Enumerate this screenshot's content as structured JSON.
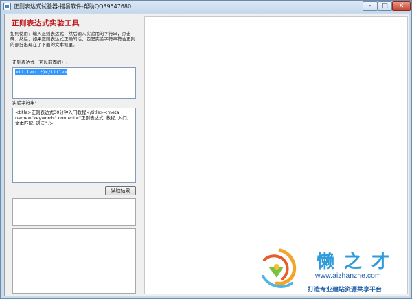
{
  "window": {
    "title": "正则表达式试验器-搭易软件-帮助QQ39547680",
    "minimize_glyph": "–",
    "maximize_glyph": "□",
    "close_glyph": "✕"
  },
  "panel": {
    "heading": "正则表达式实验工具",
    "intro": "如何使用？输入正则表达式，然后输入实验用的字符串，点击确，然后，如果正则表达式正确的话，匹配实验字符串符合正则的部分出现在了下面的文本框里。",
    "regex_label": "正则表达式（可以前面的）:",
    "regex_value": "<title>(.*)</title>",
    "test_label": "实验字符串:",
    "test_value": "<title>正则表达式30分钟入门教程</title><meta name=\"keywords\" content=\"正则表达式, 教程, 入门, 文本匹配, 语法\" />",
    "run_button": "试验结果"
  },
  "watermark": {
    "brand": "懒之才",
    "url": "www.aizhanzhe.com",
    "slogan": "打造专业建站资源共享平台"
  },
  "colors": {
    "heading": "#c0191c",
    "selection": "#3399ff",
    "watermark_blue": "#2f9bd8"
  }
}
